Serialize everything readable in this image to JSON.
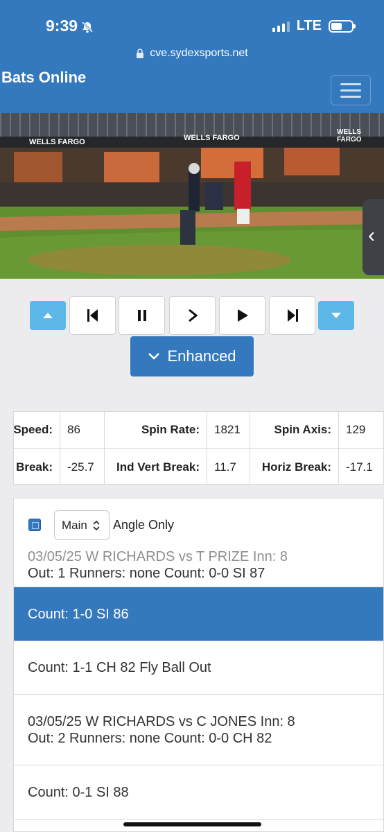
{
  "status": {
    "time": "9:39",
    "network": "LTE"
  },
  "browser": {
    "url": "cve.sydexsports.net"
  },
  "header": {
    "brand": "Bats Online"
  },
  "video": {
    "banner_left": "WELLS FARGO",
    "banner_mid": "WELLS FARGO",
    "banner_right": "WELLS FARGO"
  },
  "enhanced": {
    "label": "Enhanced"
  },
  "stats": {
    "speed_label": "Speed:",
    "speed_value": "86",
    "spin_rate_label": "Spin Rate:",
    "spin_rate_value": "1821",
    "spin_axis_label": "Spin Axis:",
    "spin_axis_value": "129",
    "break_label": "Break:",
    "break_value": "-25.7",
    "ind_vert_label": "Ind Vert Break:",
    "ind_vert_value": "11.7",
    "horiz_label": "Horiz Break:",
    "horiz_value": "-17.1"
  },
  "panel": {
    "select_value": "Main",
    "angle_only": "Angle Only",
    "rows": [
      {
        "line1": "03/05/25 W RICHARDS vs T PRIZE Inn: 8",
        "line2": "Out: 1 Runners: none Count: 0-0 SI 87"
      },
      {
        "line1": "Count: 1-0 SI 86"
      },
      {
        "line1": "Count: 1-1 CH 82 Fly Ball Out"
      },
      {
        "line1": "03/05/25 W RICHARDS vs C JONES Inn: 8",
        "line2": "Out: 2 Runners: none Count: 0-0 CH 82"
      },
      {
        "line1": "Count: 0-1 SI 88"
      }
    ]
  },
  "colors": {
    "accent": "#3478be",
    "light_blue": "#5bb8e8",
    "background": "#ececef"
  }
}
